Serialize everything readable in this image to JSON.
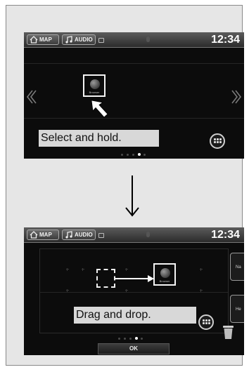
{
  "step1": {
    "status": {
      "map_label": "MAP",
      "audio_label": "AUDIO",
      "clock": "12:34"
    },
    "app": {
      "label": "Browser",
      "icon": "globe-icon"
    },
    "caption": "Select and hold.",
    "pager": {
      "count": 5,
      "active": 3
    }
  },
  "step2": {
    "status": {
      "map_label": "MAP",
      "audio_label": "AUDIO",
      "clock": "12:34"
    },
    "app": {
      "label": "Browser",
      "icon": "globe-icon"
    },
    "caption": "Drag and drop.",
    "side_tabs": [
      "Na",
      "He"
    ],
    "ok_label": "OK",
    "pager": {
      "count": 5,
      "active": 3
    }
  },
  "colors": {
    "screen_bg": "#0c0c0c",
    "panel_bg": "#e6e6e6",
    "caption_bg": "#d8d8d8",
    "highlight": "#f4f4f4"
  }
}
